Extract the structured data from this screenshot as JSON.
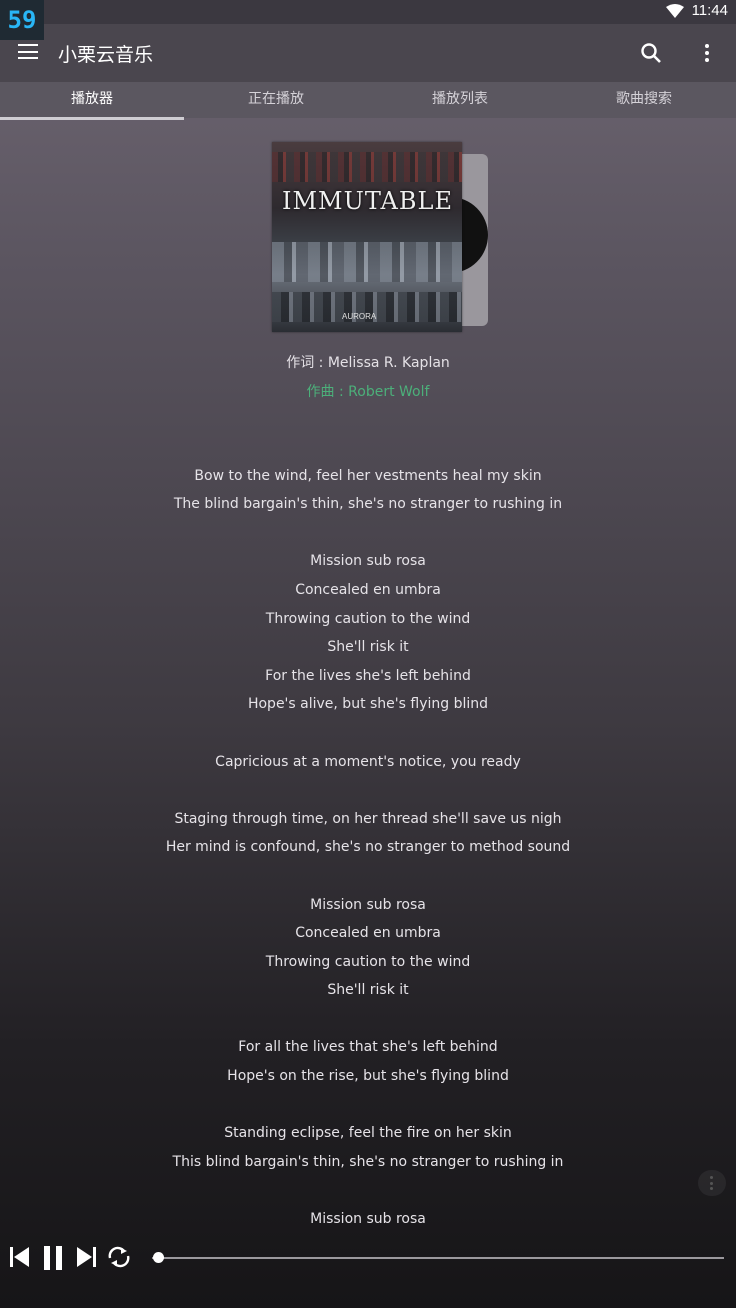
{
  "fps_counter": "59",
  "status": {
    "time": "11:44"
  },
  "appbar": {
    "title": "小栗云音乐"
  },
  "tabs": [
    {
      "label": "播放器",
      "active": true
    },
    {
      "label": "正在播放",
      "active": false
    },
    {
      "label": "播放列表",
      "active": false
    },
    {
      "label": "歌曲搜索",
      "active": false
    }
  ],
  "album": {
    "cover_title": "IMMUTABLE",
    "cover_label": "AURORA"
  },
  "credits": {
    "lyricist": "作词 : Melissa R. Kaplan",
    "composer": "作曲 : Robert Wolf"
  },
  "lyrics": [
    "",
    "Bow to the wind, feel her vestments heal my skin",
    "The blind bargain's thin, she's no stranger to rushing in",
    "",
    "Mission sub rosa",
    "Concealed en umbra",
    "Throwing caution to the wind",
    "She'll risk it",
    "For the lives she's left behind",
    "Hope's alive, but she's flying blind",
    "",
    "Capricious at a moment's notice, you ready",
    "",
    "Staging through time, on her thread she'll save us nigh",
    "Her mind is confound, she's no stranger to method sound",
    "",
    "Mission sub rosa",
    "Concealed en umbra",
    "Throwing caution to the wind",
    "She'll risk it",
    "",
    "For all the lives that she's left behind",
    "Hope's on the rise, but she's flying blind",
    "",
    "Standing eclipse, feel the fire on her skin",
    "This blind bargain's thin, she's no stranger to rushing in",
    "",
    "Mission sub rosa"
  ],
  "player": {
    "progress": 0.01
  },
  "colors": {
    "composer": "#4caf7a",
    "fps": "#29b6f6"
  }
}
